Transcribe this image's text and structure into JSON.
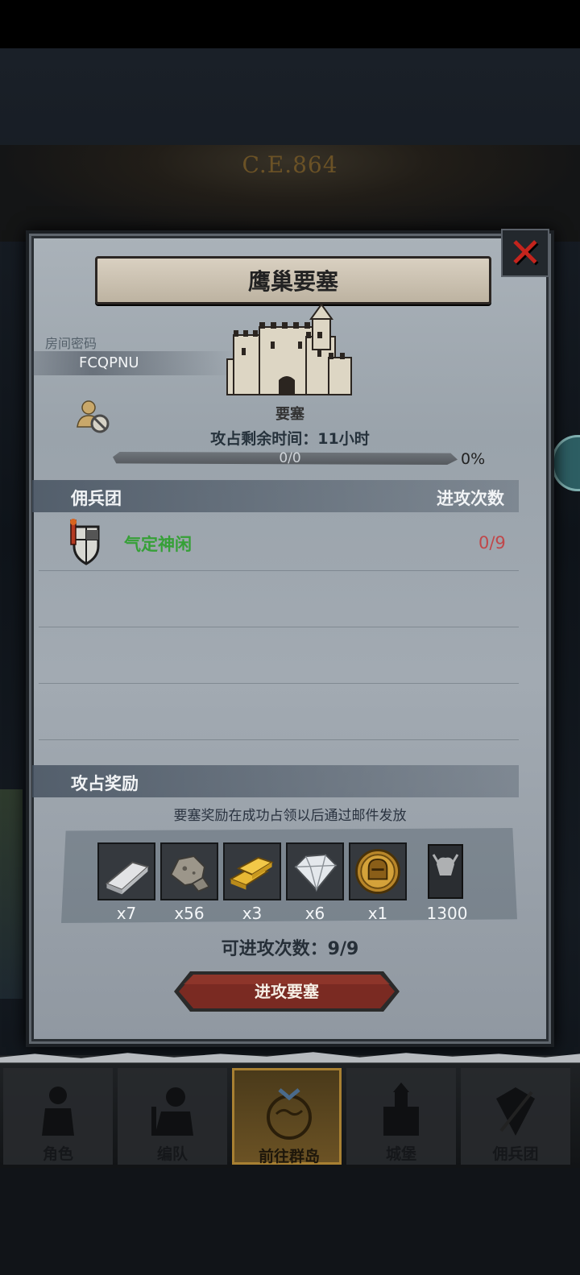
{
  "background": {
    "era_label": "C.E.864"
  },
  "dialog": {
    "title": "鹰巢要塞",
    "close_icon": "close-icon",
    "room": {
      "label": "房间密码",
      "code": "FCQPNU"
    },
    "target": {
      "name": "要塞",
      "time_label": "攻占剩余时间：11小时"
    },
    "progress": {
      "text": "0/0",
      "percent_text": "0%",
      "value": 0
    },
    "guild_header": {
      "left": "佣兵团",
      "right": "进攻次数"
    },
    "guilds": [
      {
        "name": "气定神闲",
        "count": "0/9"
      }
    ],
    "rewards": {
      "header": "攻占奖励",
      "note": "要塞奖励在成功占领以后通过邮件发放",
      "items": [
        {
          "icon": "silver-bar-icon",
          "qty": "x7"
        },
        {
          "icon": "ore-rock-icon",
          "qty": "x56"
        },
        {
          "icon": "gold-bar-icon",
          "qty": "x3"
        },
        {
          "icon": "diamond-icon",
          "qty": "x6"
        },
        {
          "icon": "helmet-coin-icon",
          "qty": "x1"
        },
        {
          "icon": "banner-token-icon",
          "qty": "1300"
        }
      ]
    },
    "attempts_label": "可进攻次数：9/9",
    "attack_button": "进攻要塞"
  },
  "bottom_nav": [
    {
      "label": "角色",
      "icon": "character-icon",
      "active": false
    },
    {
      "label": "编队",
      "icon": "formation-icon",
      "active": false
    },
    {
      "label": "前往群岛",
      "icon": "globe-icon",
      "active": true
    },
    {
      "label": "城堡",
      "icon": "castle-icon",
      "active": false
    },
    {
      "label": "佣兵团",
      "icon": "mercenary-icon",
      "active": false
    }
  ],
  "colors": {
    "accent_red": "#c4241d",
    "guild_green": "#36a037",
    "count_red": "#c0474a"
  }
}
